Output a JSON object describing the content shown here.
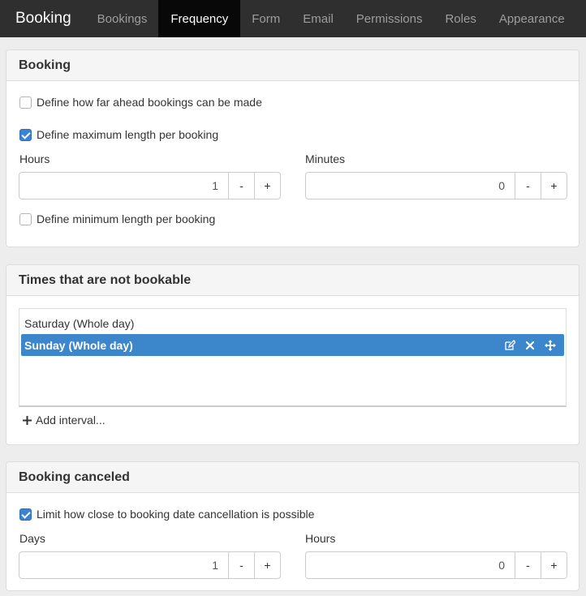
{
  "nav": {
    "brand": "Booking",
    "items": [
      {
        "label": "Bookings",
        "active": false
      },
      {
        "label": "Frequency",
        "active": true
      },
      {
        "label": "Form",
        "active": false
      },
      {
        "label": "Email",
        "active": false
      },
      {
        "label": "Permissions",
        "active": false
      },
      {
        "label": "Roles",
        "active": false
      },
      {
        "label": "Appearance",
        "active": false
      }
    ]
  },
  "booking_panel": {
    "title": "Booking",
    "ahead_label": "Define how far ahead bookings can be made",
    "ahead_checked": false,
    "maxlen_label": "Define maximum length per booking",
    "maxlen_checked": true,
    "hours_label": "Hours",
    "hours_value": "1",
    "minutes_label": "Minutes",
    "minutes_value": "0",
    "minlen_label": "Define minimum length per booking",
    "minlen_checked": false
  },
  "stepper": {
    "minus": "-",
    "plus": "+"
  },
  "times_panel": {
    "title": "Times that are not bookable",
    "items": [
      {
        "label": "Saturday (Whole day)",
        "selected": false
      },
      {
        "label": "Sunday (Whole day)",
        "selected": true
      }
    ],
    "add_label": "Add interval..."
  },
  "cancel_panel": {
    "title": "Booking canceled",
    "limit_label": "Limit how close to booking date cancellation is possible",
    "limit_checked": true,
    "days_label": "Days",
    "days_value": "1",
    "hours_label": "Hours",
    "hours_value": "0"
  },
  "colors": {
    "navbar": "#2f2f2f",
    "nav_active": "#080808",
    "accent": "#3c87cc"
  },
  "icons": {
    "edit": "edit-icon",
    "delete": "close-icon",
    "move": "move-icon",
    "add": "plus-icon"
  }
}
